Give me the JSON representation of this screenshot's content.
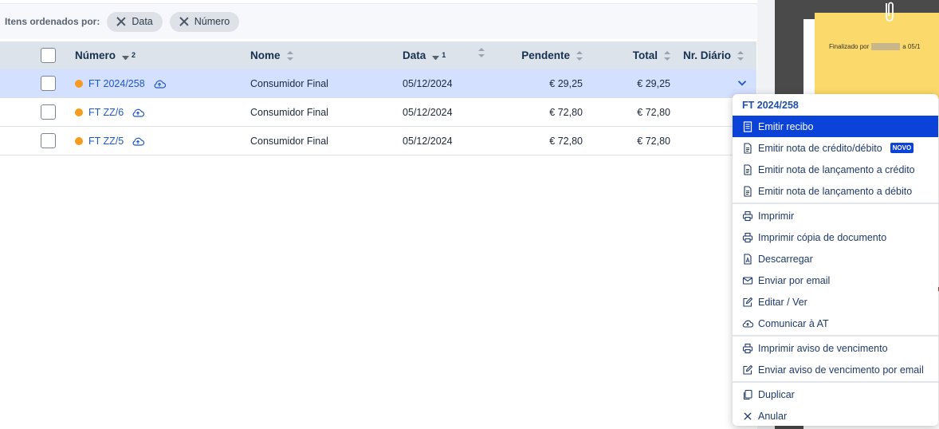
{
  "filters": {
    "label": "Itens ordenados por:",
    "chips": [
      "Data",
      "Número"
    ]
  },
  "table": {
    "headers": {
      "numero": "Número",
      "numero_sort_index": "2",
      "nome": "Nome",
      "data": "Data",
      "data_sort_index": "1",
      "pendente": "Pendente",
      "total": "Total",
      "diario": "Nr. Diário"
    },
    "rows": [
      {
        "numero": "FT 2024/258",
        "nome": "Consumidor Final",
        "data": "05/12/2024",
        "pendente": "€ 29,25",
        "total": "€ 29,25",
        "selected": true
      },
      {
        "numero": "FT ZZ/6",
        "nome": "Consumidor Final",
        "data": "05/12/2024",
        "pendente": "€ 72,80",
        "total": "€ 72,80",
        "selected": false
      },
      {
        "numero": "FT ZZ/5",
        "nome": "Consumidor Final",
        "data": "05/12/2024",
        "pendente": "€ 72,80",
        "total": "€ 72,80",
        "selected": false
      }
    ]
  },
  "menu": {
    "title": "FT 2024/258",
    "groups": [
      [
        {
          "label": "Emitir recibo",
          "icon": "receipt-icon",
          "active": true
        },
        {
          "label": "Emitir nota de crédito/débito",
          "icon": "document-icon",
          "badge": "NOVO"
        },
        {
          "label": "Emitir nota de lançamento a crédito",
          "icon": "document-icon"
        },
        {
          "label": "Emitir nota de lançamento a débito",
          "icon": "document-icon"
        }
      ],
      [
        {
          "label": "Imprimir",
          "icon": "printer-icon"
        },
        {
          "label": "Imprimir cópia de documento",
          "icon": "printer-icon"
        },
        {
          "label": "Descarregar",
          "icon": "pdf-icon"
        },
        {
          "label": "Enviar por email",
          "icon": "mail-icon"
        },
        {
          "label": "Editar / Ver",
          "icon": "edit-icon"
        },
        {
          "label": "Comunicar à AT",
          "icon": "cloud-upload-icon"
        }
      ],
      [
        {
          "label": "Imprimir aviso de vencimento",
          "icon": "printer-icon"
        },
        {
          "label": "Enviar aviso de vencimento por email",
          "icon": "edit-icon"
        }
      ],
      [
        {
          "label": "Duplicar",
          "icon": "copy-icon"
        },
        {
          "label": "Anular",
          "icon": "close-icon"
        }
      ]
    ]
  },
  "preview": {
    "note_prefix": "Finalizado por",
    "note_suffix": "a 05/1"
  },
  "colors": {
    "accent": "#0b43d9",
    "link": "#1f59c7",
    "status_dot": "#f59b1f",
    "selected_row": "#d4e0ff",
    "header_bg": "#dde3ea"
  }
}
